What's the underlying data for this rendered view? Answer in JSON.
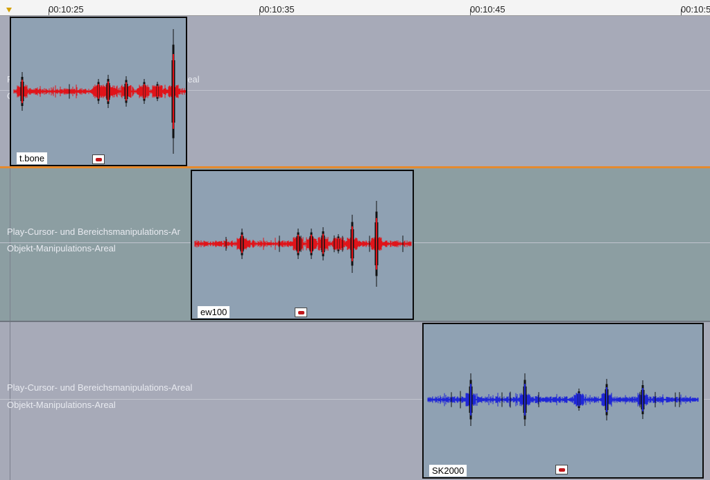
{
  "ruler": {
    "play_marker_icon": "play-cursor-marker",
    "labels": [
      "00:10:25",
      "00:10:35",
      "00:10:45",
      "00:10:5"
    ]
  },
  "tracks": [
    {
      "labels": [
        "P",
        "O",
        "real"
      ],
      "clip": {
        "name": "t.bone",
        "color": "#e0141a",
        "icon": "clip-color-icon"
      }
    },
    {
      "labels": [
        "Play-Cursor- und Bereichsmanipulations-Ar",
        "Objekt-Manipulations-Areal"
      ],
      "clip": {
        "name": "ew100",
        "color": "#e0141a",
        "icon": "clip-color-icon"
      }
    },
    {
      "labels": [
        "Play-Cursor- und Bereichsmanipulations-Areal",
        "Objekt-Manipulations-Areal"
      ],
      "clip": {
        "name": "SK2000",
        "color": "#1f27d6",
        "icon": "clip-color-icon"
      }
    }
  ],
  "colors": {
    "selected_track_border": "#e58a2e",
    "track_background": "#a7aab8",
    "active_track_background": "#8c9ea2",
    "clip_background": "#8fa1b3"
  }
}
